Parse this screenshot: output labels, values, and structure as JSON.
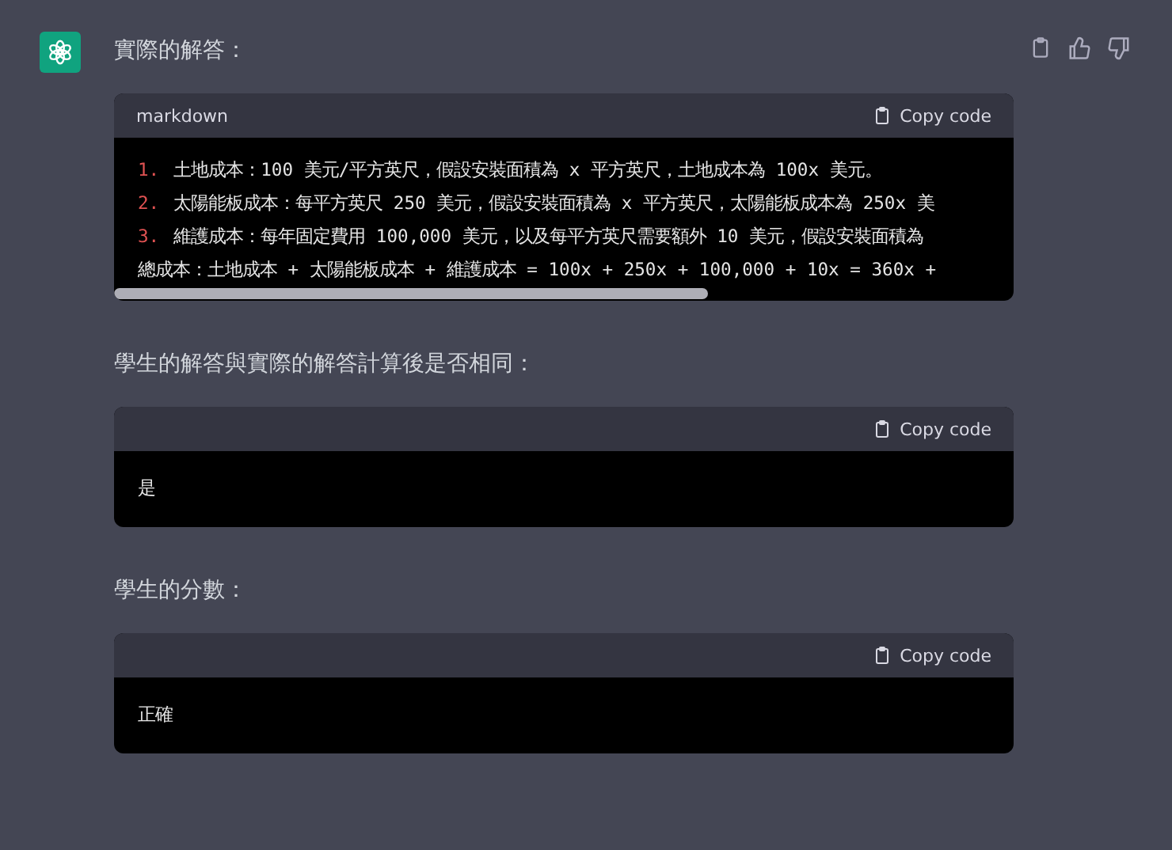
{
  "message": {
    "blocks": [
      {
        "kind": "text",
        "text": "實際的解答："
      },
      {
        "kind": "code",
        "language": "markdown",
        "copy_label": "Copy code",
        "scrollbar": true,
        "lines": [
          {
            "number": "1.",
            "text": "土地成本：100 美元/平方英尺，假設安裝面積為 x 平方英尺，土地成本為 100x 美元。"
          },
          {
            "number": "2.",
            "text": "太陽能板成本：每平方英尺 250 美元，假設安裝面積為 x 平方英尺，太陽能板成本為 250x 美"
          },
          {
            "number": "3.",
            "text": "維護成本：每年固定費用 100,000 美元，以及每平方英尺需要額外 10 美元，假設安裝面積為"
          },
          {
            "text": "總成本：土地成本 + 太陽能板成本 + 維護成本 = 100x + 250x + 100,000 + 10x = 360x +"
          }
        ]
      },
      {
        "kind": "text",
        "text": "學生的解答與實際的解答計算後是否相同："
      },
      {
        "kind": "code",
        "copy_label": "Copy code",
        "scrollbar": false,
        "lines": [
          {
            "text": "是"
          }
        ]
      },
      {
        "kind": "text",
        "text": "學生的分數："
      },
      {
        "kind": "code",
        "copy_label": "Copy code",
        "scrollbar": false,
        "lines": [
          {
            "text": "正確"
          }
        ]
      }
    ]
  }
}
